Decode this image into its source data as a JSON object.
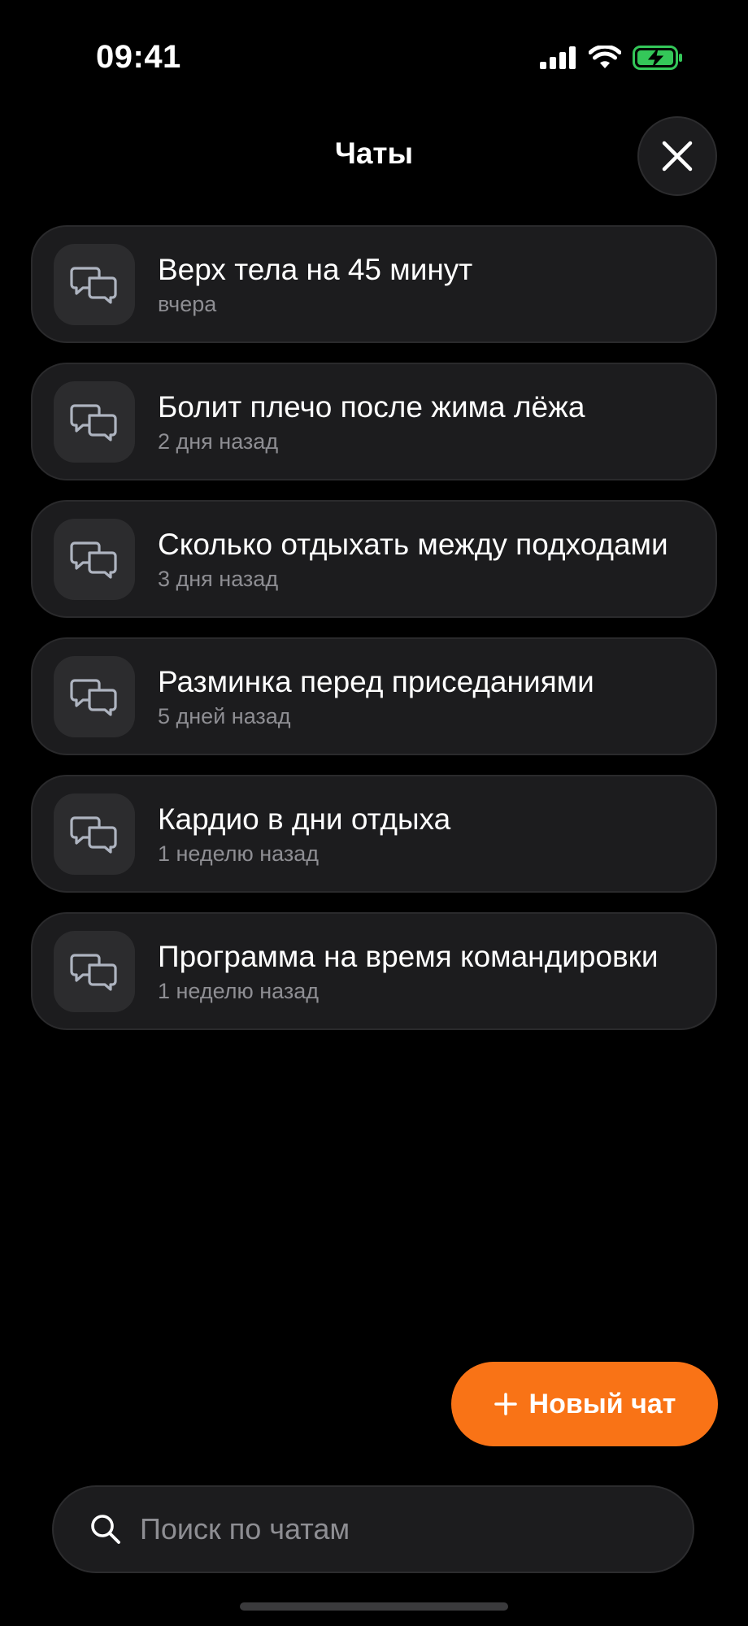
{
  "status_bar": {
    "time": "09:41"
  },
  "header": {
    "title": "Чаты"
  },
  "chats": [
    {
      "title": "Верх тела на 45 минут",
      "time": "вчера"
    },
    {
      "title": "Болит плечо после жима лёжа",
      "time": "2 дня назад"
    },
    {
      "title": "Сколько отдыхать между подходами",
      "time": "3 дня назад"
    },
    {
      "title": "Разминка перед приседаниями",
      "time": "5 дней назад"
    },
    {
      "title": "Кардио в дни отдыха",
      "time": "1 неделю назад"
    },
    {
      "title": "Программа на время командировки",
      "time": "1 неделю назад"
    }
  ],
  "new_chat": {
    "label": "Новый чат",
    "icon": "plus-icon",
    "color": "#f97316"
  },
  "search": {
    "placeholder": "Поиск по чатам",
    "value": "",
    "icon": "search-icon"
  },
  "colors": {
    "background": "#000000",
    "card": "#1c1c1e",
    "accent": "#f97316",
    "battery": "#34c759"
  }
}
